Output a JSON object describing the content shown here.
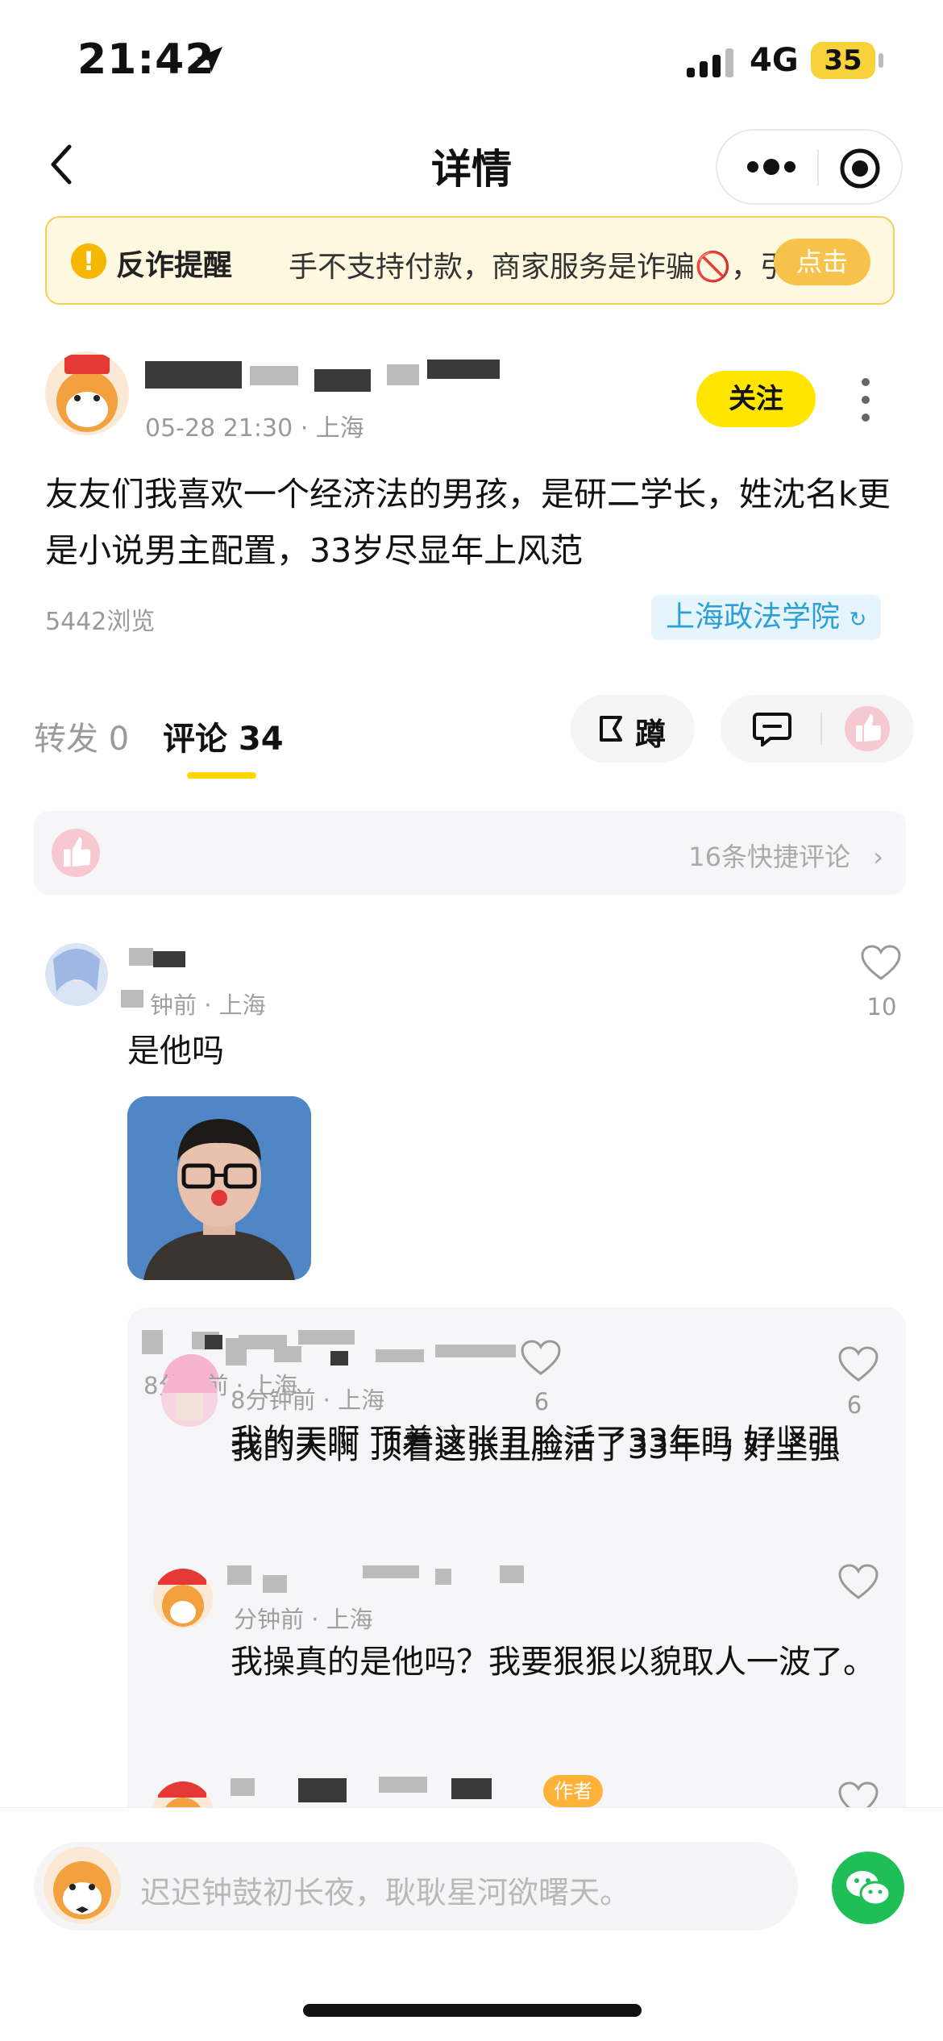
{
  "status_bar": {
    "time": "21:42",
    "network": "4G",
    "battery": "35"
  },
  "nav": {
    "title": "详情"
  },
  "notice": {
    "title": "反诈提醒",
    "text": "手不支持付款，商家服务是诈骗🚫，引流",
    "button": "点击"
  },
  "post": {
    "meta": "05-28 21:30 · 上海",
    "follow": "关注",
    "text": "友友们我喜欢一个经济法的男孩，是研二学长，姓沈名k更是小说男主配置，33岁尽显年上风范",
    "views": "5442浏览",
    "tag": "上海政法学院"
  },
  "tabs": {
    "repost": "转发 0",
    "comments": "评论 34",
    "dun": "蹲"
  },
  "quick_comments": {
    "text": "16条快捷评论"
  },
  "comments": [
    {
      "meta": "钟前 · 上海",
      "text": "是他吗",
      "likes": "10"
    }
  ],
  "replies": [
    {
      "meta": "8分钟前 · 上海",
      "text": "我的天啊 顶着这张丑脸活了33年吗 好坚强",
      "likes": "6"
    },
    {
      "meta": "分钟前 · 上海",
      "text": "我操真的是他吗？我要狠狠以貌取人一波了。"
    },
    {
      "tag": "作者"
    }
  ],
  "input": {
    "placeholder": "迟迟钟鼓初长夜，耿耿星河欲曙天。"
  },
  "colors": {
    "accent": "#ffe600",
    "tag_bg": "#e6f4fb",
    "tag_text": "#2a9fd8",
    "wechat": "#1ebf57"
  }
}
